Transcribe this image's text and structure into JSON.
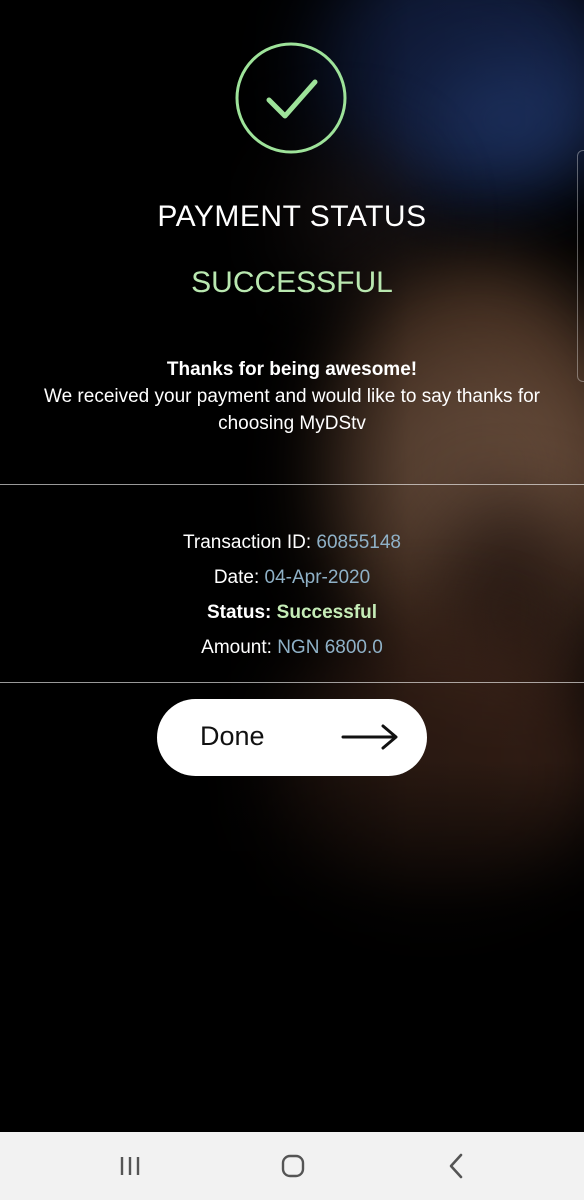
{
  "status": {
    "title": "PAYMENT STATUS",
    "result": "SUCCESSFUL",
    "icon": "check-circle-icon",
    "accent_color": "#9ee39a"
  },
  "message": {
    "heading": "Thanks for being awesome!",
    "body": "We received your payment and would like to say thanks for choosing MyDStv"
  },
  "transaction": {
    "id_label": "Transaction ID:",
    "id_value": "60855148",
    "date_label": "Date:",
    "date_value": "04-Apr-2020",
    "status_label": "Status:",
    "status_value": "Successful",
    "amount_label": "Amount:",
    "amount_value": "NGN 6800.0"
  },
  "actions": {
    "done_label": "Done",
    "done_icon": "arrow-right-icon"
  },
  "system_nav": {
    "recents_icon": "recents-icon",
    "home_icon": "home-icon",
    "back_icon": "back-icon"
  }
}
